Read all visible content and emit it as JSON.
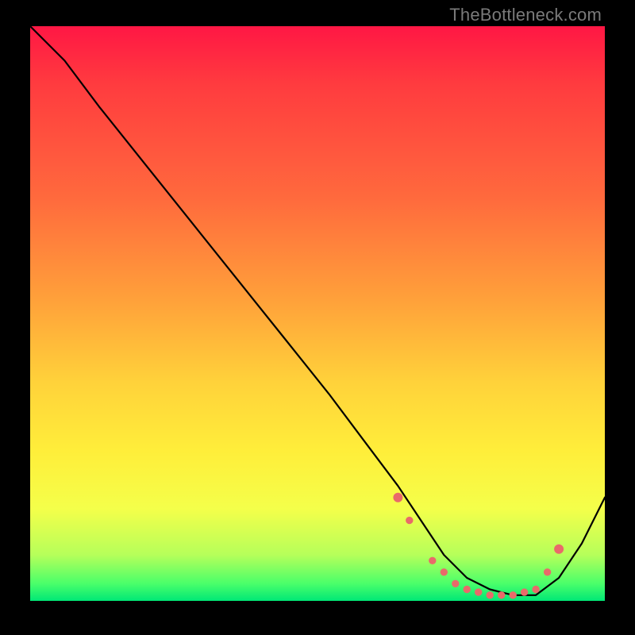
{
  "watermark": "TheBottleneck.com",
  "chart_data": {
    "type": "line",
    "title": "",
    "xlabel": "",
    "ylabel": "",
    "xlim": [
      0,
      100
    ],
    "ylim": [
      0,
      100
    ],
    "grid": false,
    "legend": false,
    "series": [
      {
        "name": "bottleneck-curve",
        "x": [
          0,
          6,
          12,
          20,
          28,
          36,
          44,
          52,
          58,
          64,
          68,
          72,
          76,
          80,
          84,
          88,
          92,
          96,
          100
        ],
        "y": [
          100,
          94,
          86,
          76,
          66,
          56,
          46,
          36,
          28,
          20,
          14,
          8,
          4,
          2,
          1,
          1,
          4,
          10,
          18
        ]
      }
    ],
    "highlight_points": {
      "comment": "red dots clustered near trough of curve",
      "x": [
        64,
        66,
        70,
        72,
        74,
        76,
        78,
        80,
        82,
        84,
        86,
        88,
        90,
        92
      ],
      "y": [
        18,
        14,
        7,
        5,
        3,
        2,
        1.5,
        1,
        1,
        1,
        1.5,
        2,
        5,
        9
      ]
    },
    "background_gradient": {
      "top": "#ff1744",
      "mid_upper": "#ff6a3d",
      "mid": "#ffd23a",
      "mid_lower": "#f4ff4a",
      "bottom": "#00e776"
    }
  }
}
